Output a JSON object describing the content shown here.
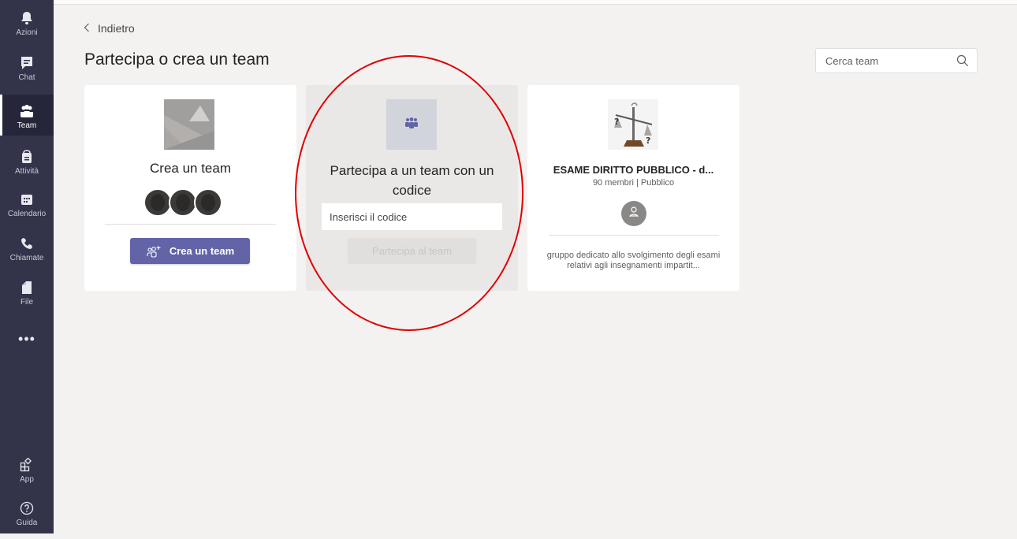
{
  "sidebar": {
    "items": [
      {
        "label": "Azioni",
        "icon": "bell-icon"
      },
      {
        "label": "Chat",
        "icon": "chat-icon"
      },
      {
        "label": "Team",
        "icon": "teams-icon",
        "active": true
      },
      {
        "label": "Attività",
        "icon": "assignments-icon"
      },
      {
        "label": "Calendario",
        "icon": "calendar-icon"
      },
      {
        "label": "Chiamate",
        "icon": "phone-icon"
      },
      {
        "label": "File",
        "icon": "file-icon"
      }
    ],
    "more": "•••",
    "bottom_items": [
      {
        "label": "App",
        "icon": "apps-icon"
      },
      {
        "label": "Guida",
        "icon": "help-icon"
      }
    ]
  },
  "header": {
    "back_label": "Indietro",
    "title": "Partecipa o crea un team",
    "search_placeholder": "Cerca team"
  },
  "cards": {
    "create": {
      "title": "Crea un team",
      "button_label": "Crea un team"
    },
    "join": {
      "title": "Partecipa a un team con un codice",
      "code_placeholder": "Inserisci il codice",
      "button_label": "Partecipa al team"
    },
    "team": {
      "name": "ESAME DIRITTO PUBBLICO - d...",
      "meta": "90 membri | Pubblico",
      "description": "gruppo dedicato allo svolgimento degli esami relativi agli insegnamenti impartit..."
    }
  },
  "colors": {
    "sidebar_bg": "#33344a",
    "accent": "#6264a7",
    "annotation_circle": "#e00000"
  }
}
